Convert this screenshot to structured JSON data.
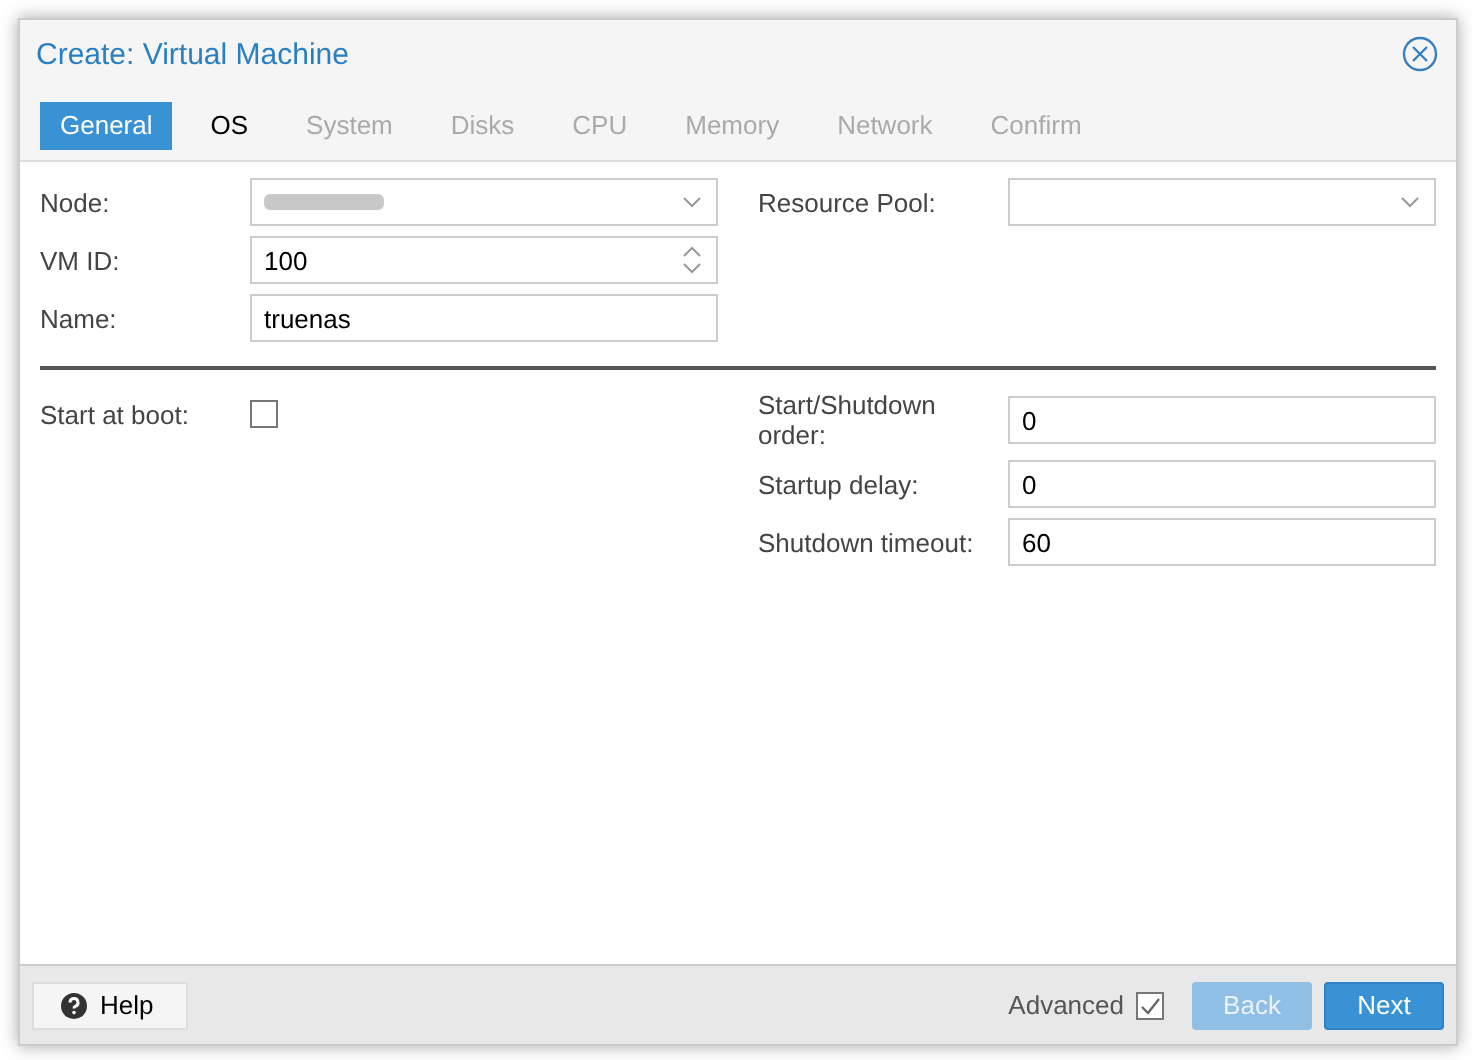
{
  "window": {
    "title": "Create: Virtual Machine"
  },
  "tabs": [
    {
      "label": "General",
      "selected": true,
      "disabled": false
    },
    {
      "label": "OS",
      "selected": false,
      "disabled": false
    },
    {
      "label": "System",
      "selected": false,
      "disabled": true
    },
    {
      "label": "Disks",
      "selected": false,
      "disabled": true
    },
    {
      "label": "CPU",
      "selected": false,
      "disabled": true
    },
    {
      "label": "Memory",
      "selected": false,
      "disabled": true
    },
    {
      "label": "Network",
      "selected": false,
      "disabled": true
    },
    {
      "label": "Confirm",
      "selected": false,
      "disabled": true
    }
  ],
  "left_fields": [
    {
      "label": "Node:",
      "kind": "combo",
      "redacted": true
    },
    {
      "label": "VM ID:",
      "kind": "spinner",
      "value": "100"
    },
    {
      "label": "Name:",
      "kind": "text",
      "value": "truenas"
    }
  ],
  "right_fields": [
    {
      "label": "Resource Pool:",
      "kind": "combo"
    }
  ],
  "start_at_boot": {
    "label": "Start at boot:",
    "checked": false
  },
  "order_fields": [
    {
      "label": "Start/Shutdown order:",
      "value": "0"
    },
    {
      "label": "Startup delay:",
      "value": "0"
    },
    {
      "label": "Shutdown timeout:",
      "value": "60"
    }
  ],
  "footer": {
    "help": "Help",
    "advanced": {
      "label": "Advanced",
      "checked": true
    },
    "back": {
      "label": "Back",
      "disabled": true
    },
    "next": {
      "label": "Next",
      "disabled": false
    }
  }
}
